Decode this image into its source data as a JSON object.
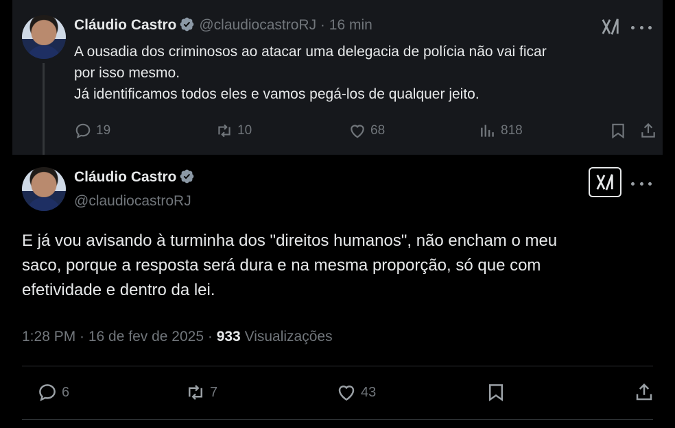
{
  "tweet1": {
    "name": "Cláudio Castro",
    "handle": "@claudiocastroRJ",
    "separator": "·",
    "time": "16 min",
    "lines": [
      "A ousadia dos criminosos ao atacar uma delegacia de polícia não vai ficar",
      "por isso mesmo.",
      "Já identificamos todos eles e vamos pegá-los de qualquer jeito."
    ],
    "stats": {
      "replies": "19",
      "reposts": "10",
      "likes": "68",
      "views": "818"
    }
  },
  "tweet2": {
    "name": "Cláudio Castro",
    "handle": "@claudiocastroRJ",
    "lines": [
      "E já vou avisando à turminha dos \"direitos humanos\", não encham o meu",
      "saco, porque a resposta será dura e na mesma proporção, só que com",
      "efetividade e dentro da lei."
    ],
    "timestamp": "1:28 PM · 16 de fev de 2025 · ",
    "views_count": "933",
    "views_label": " Visualizações",
    "stats": {
      "replies": "6",
      "reposts": "7",
      "likes": "43"
    }
  },
  "icons": {
    "verified": "verified-badge-icon",
    "grok": "grok-icon",
    "more": "more-icon",
    "reply": "reply-icon",
    "repost": "repost-icon",
    "like": "like-icon",
    "views": "views-icon",
    "bookmark": "bookmark-icon",
    "share": "share-icon"
  },
  "colors": {
    "background": "#000000",
    "highlight_background": "#16181c",
    "text": "#e7e9ea",
    "muted": "#71767b"
  }
}
